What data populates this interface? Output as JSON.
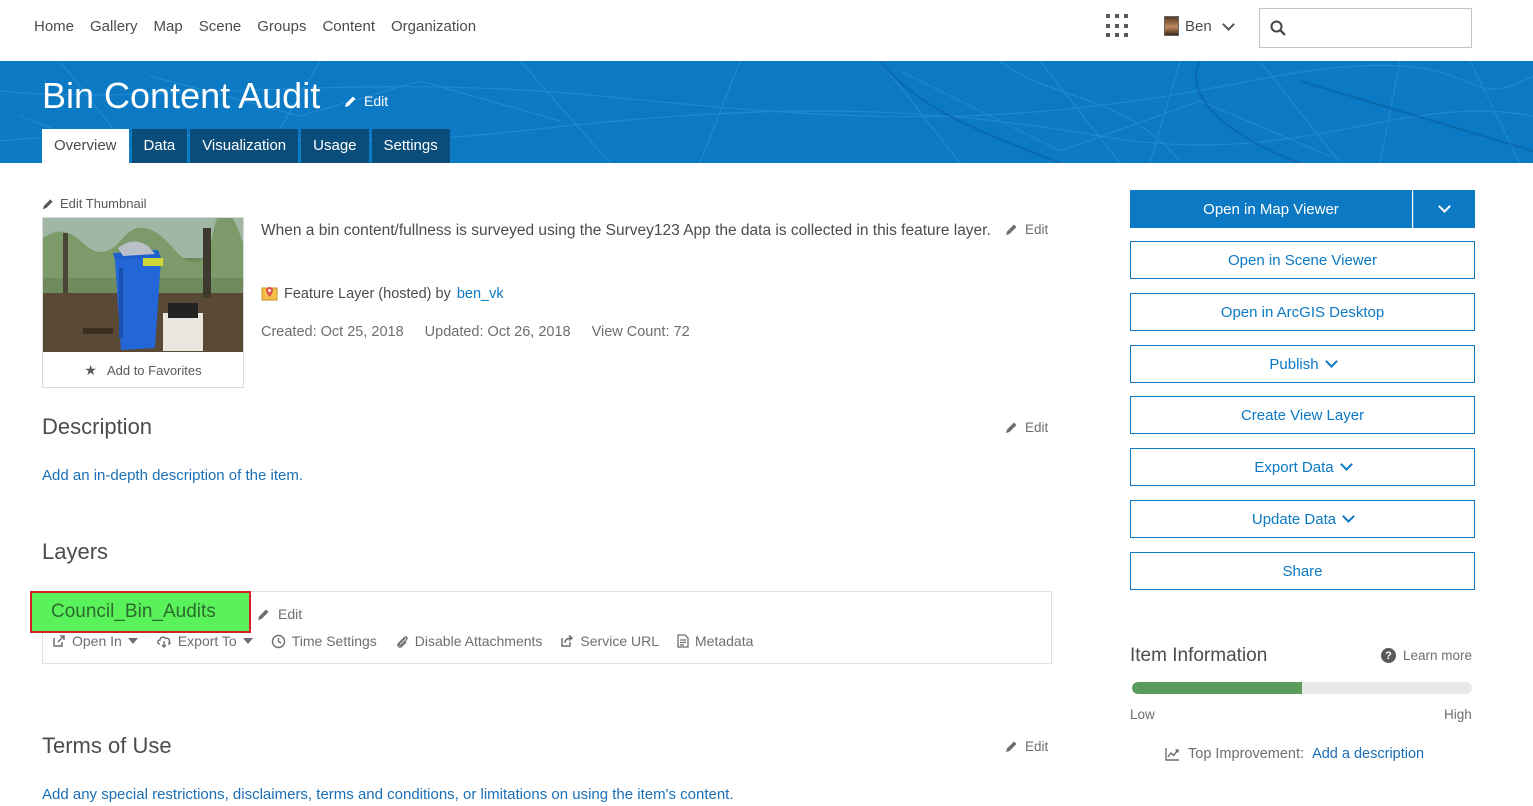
{
  "nav": {
    "links": [
      "Home",
      "Gallery",
      "Map",
      "Scene",
      "Groups",
      "Content",
      "Organization"
    ],
    "user_name": "Ben",
    "search_placeholder": ""
  },
  "header": {
    "title": "Bin Content Audit",
    "edit_label": "Edit",
    "tabs": [
      "Overview",
      "Data",
      "Visualization",
      "Usage",
      "Settings"
    ],
    "active_tab": "Overview"
  },
  "overview": {
    "edit_thumbnail_label": "Edit Thumbnail",
    "add_favorites_label": "Add to Favorites",
    "summary": "When a bin content/fullness is surveyed using the Survey123 App the data is collected in this feature layer.",
    "summary_edit_label": "Edit",
    "item_type": "Feature Layer (hosted) by",
    "owner": "ben_vk",
    "created": "Created: Oct 25, 2018",
    "updated": "Updated: Oct 26, 2018",
    "view_count": "View Count: 72"
  },
  "description": {
    "title": "Description",
    "edit_label": "Edit",
    "placeholder_link": "Add an in-depth description of the item."
  },
  "layers": {
    "title": "Layers",
    "layer_name": "Council_Bin_Audits",
    "edit_label": "Edit",
    "actions": {
      "open_in": "Open In",
      "export_to": "Export To",
      "time_settings": "Time Settings",
      "disable_attachments": "Disable Attachments",
      "service_url": "Service URL",
      "metadata": "Metadata"
    }
  },
  "terms": {
    "title": "Terms of Use",
    "edit_label": "Edit",
    "placeholder_link": "Add any special restrictions, disclaimers, terms and conditions, or limitations on using the item's content."
  },
  "sidebar": {
    "open_map_viewer": "Open in Map Viewer",
    "open_scene_viewer": "Open in Scene Viewer",
    "open_arcgis_desktop": "Open in ArcGIS Desktop",
    "publish": "Publish",
    "create_view_layer": "Create View Layer",
    "export_data": "Export Data",
    "update_data": "Update Data",
    "share": "Share"
  },
  "item_information": {
    "title": "Item Information",
    "learn_more": "Learn more",
    "progress_fraction": 0.5,
    "low_label": "Low",
    "high_label": "High",
    "top_improvement_label": "Top Improvement:",
    "top_improvement_link": "Add a description"
  },
  "colors": {
    "brand_blue": "#0b79c4",
    "tab_dark": "#0a4c7a",
    "layer_highlight": "#5af25a",
    "layer_border": "#d61f26",
    "progress_fill": "#5a9a5a"
  }
}
